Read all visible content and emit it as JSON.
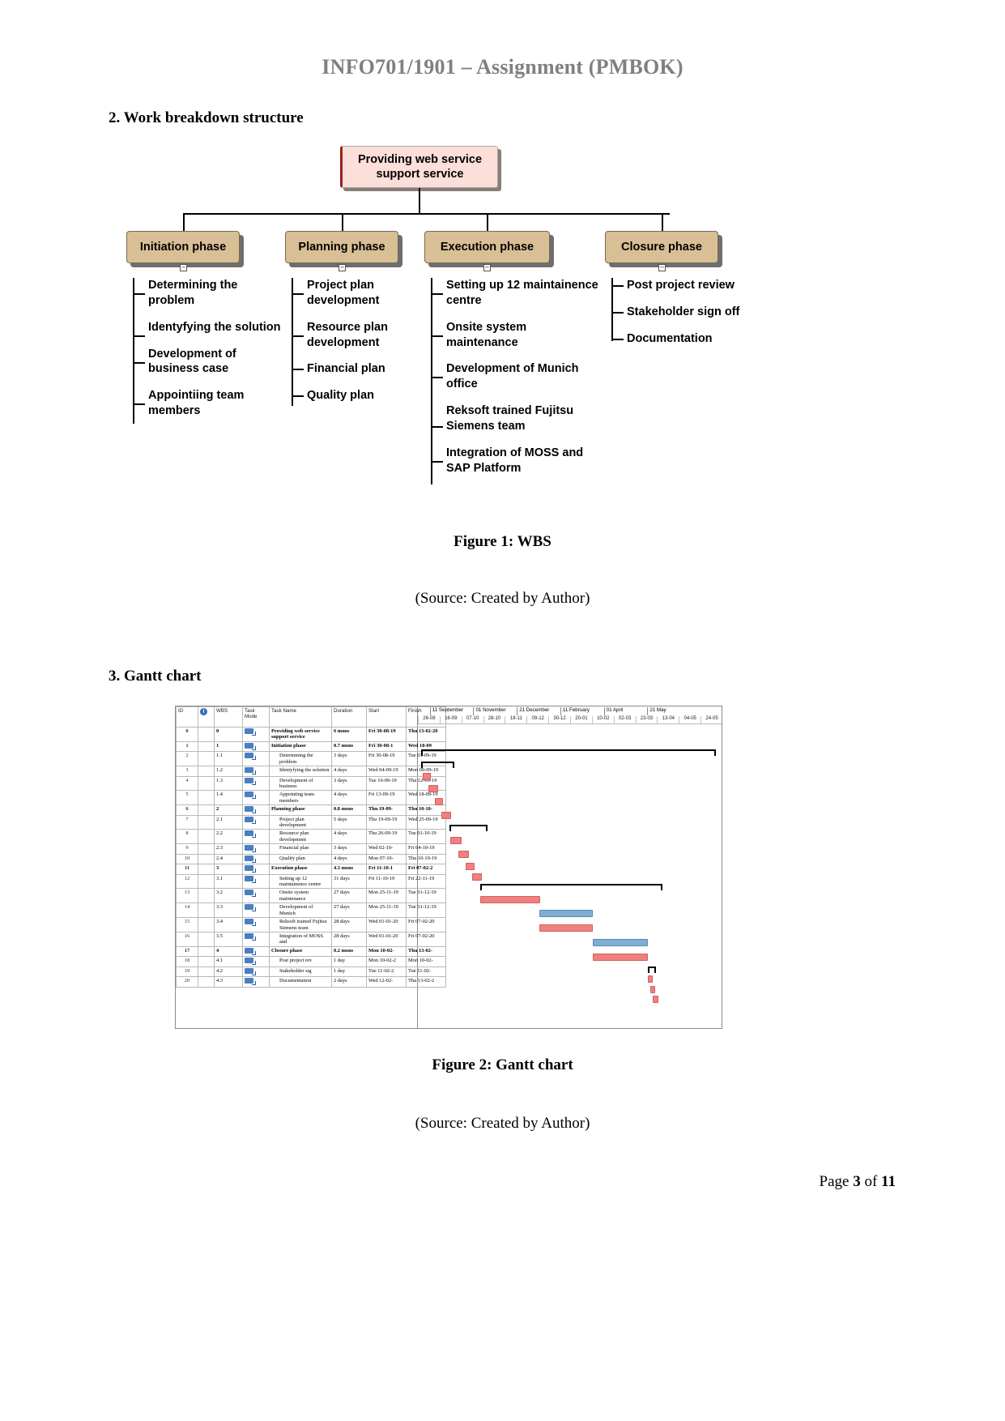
{
  "header": {
    "title": "INFO701/1901 – Assignment (PMBOK)"
  },
  "sections": {
    "wbs_heading": "2. Work breakdown structure",
    "gantt_heading": "3. Gantt chart"
  },
  "wbs": {
    "root": "Providing web service support service",
    "toggle_glyph": "–",
    "phases": [
      {
        "label": "Initiation phase",
        "items": [
          "Determining the problem",
          "Identyfying the solution",
          "Development of business case",
          "Appointiing team members"
        ]
      },
      {
        "label": "Planning phase",
        "items": [
          "Project plan development",
          "Resource plan development",
          "Financial plan",
          "Quality plan"
        ]
      },
      {
        "label": "Execution phase",
        "items": [
          "Setting up 12 maintainence centre",
          "Onsite system maintenance",
          "Development of Munich office",
          "Reksoft trained Fujitsu Siemens team",
          "Integration of MOSS and SAP Platform"
        ]
      },
      {
        "label": "Closure phase",
        "items": [
          "Post project review",
          "Stakeholder sign off",
          "Documentation"
        ]
      }
    ]
  },
  "figures": {
    "fig1_caption": "Figure 1: WBS",
    "fig1_source": "(Source: Created by Author)",
    "fig2_caption": "Figure 2: Gantt chart",
    "fig2_source": "(Source: Created by Author)"
  },
  "gantt": {
    "columns": [
      "ID",
      "",
      "WBS",
      "Task Mode",
      "Task Name",
      "Duration",
      "Start",
      "Finish"
    ],
    "info_icon_glyph": "i",
    "timeline": {
      "major_ticks": [
        "11 September",
        "01 November",
        "21 December",
        "11 February",
        "01 April",
        "21 May"
      ],
      "minor_ticks": [
        "26-08",
        "16-09",
        "07-10",
        "28-10",
        "18-11",
        "09-12",
        "30-12",
        "20-01",
        "10-02",
        "02-03",
        "23-03",
        "13-04",
        "04-05",
        "24-05"
      ]
    },
    "rows": [
      {
        "id": "0",
        "wbs": "0",
        "name": "Providing web service support service",
        "duration": "6 mons",
        "start": "Fri 30-08-19",
        "finish": "Thu 13-02-20",
        "summary": true,
        "indent": 0,
        "bar_start": 1.0,
        "bar_len": 97.0,
        "bar_type": "summary"
      },
      {
        "id": "1",
        "wbs": "1",
        "name": "Initiation phase",
        "duration": "0.7 mons",
        "start": "Fri 30-08-1",
        "finish": "Wed 18-09",
        "summary": true,
        "indent": 1,
        "bar_start": 1.0,
        "bar_len": 11.0,
        "bar_type": "summary"
      },
      {
        "id": "2",
        "wbs": "1.1",
        "name": "Determining the problem",
        "duration": "3 days",
        "start": "Fri 30-08-19",
        "finish": "Tue 03-09-19",
        "summary": false,
        "indent": 2,
        "bar_start": 1.5,
        "bar_len": 2.2,
        "bar_type": "task"
      },
      {
        "id": "3",
        "wbs": "1.2",
        "name": "Identyfying the solution",
        "duration": "4 days",
        "start": "Wed 04-09-19",
        "finish": "Mon 09-09-19",
        "summary": false,
        "indent": 2,
        "bar_start": 3.4,
        "bar_len": 2.6,
        "bar_type": "task"
      },
      {
        "id": "4",
        "wbs": "1.3",
        "name": "Development of business",
        "duration": "3 days",
        "start": "Tue 10-09-19",
        "finish": "Thu 12-09-19",
        "summary": false,
        "indent": 2,
        "bar_start": 5.6,
        "bar_len": 2.2,
        "bar_type": "task"
      },
      {
        "id": "5",
        "wbs": "1.4",
        "name": "Appointing team members",
        "duration": "4 days",
        "start": "Fri 13-09-19",
        "finish": "Wed 18-09-19",
        "summary": false,
        "indent": 2,
        "bar_start": 7.6,
        "bar_len": 2.8,
        "bar_type": "task"
      },
      {
        "id": "6",
        "wbs": "2",
        "name": "Planning phase",
        "duration": "0.8 mons",
        "start": "Thu 19-09-",
        "finish": "Thu 10-10-",
        "summary": true,
        "indent": 1,
        "bar_start": 10.4,
        "bar_len": 12.5,
        "bar_type": "summary"
      },
      {
        "id": "7",
        "wbs": "2.1",
        "name": "Project plan development",
        "duration": "5 days",
        "start": "Thu 19-09-19",
        "finish": "Wed 25-09-19",
        "summary": false,
        "indent": 2,
        "bar_start": 10.6,
        "bar_len": 3.2,
        "bar_type": "task"
      },
      {
        "id": "8",
        "wbs": "2.2",
        "name": "Resource plan development",
        "duration": "4 days",
        "start": "Thu 26-09-19",
        "finish": "Tue 01-10-19",
        "summary": false,
        "indent": 2,
        "bar_start": 13.4,
        "bar_len": 2.8,
        "bar_type": "task"
      },
      {
        "id": "9",
        "wbs": "2.3",
        "name": "Financial plan",
        "duration": "3 days",
        "start": "Wed 02-10-",
        "finish": "Fri 04-10-19",
        "summary": false,
        "indent": 2,
        "bar_start": 15.8,
        "bar_len": 2.2,
        "bar_type": "task"
      },
      {
        "id": "10",
        "wbs": "2.4",
        "name": "Quality plan",
        "duration": "4 days",
        "start": "Mon 07-10-",
        "finish": "Thu 10-10-19",
        "summary": false,
        "indent": 2,
        "bar_start": 17.8,
        "bar_len": 2.8,
        "bar_type": "task"
      },
      {
        "id": "11",
        "wbs": "3",
        "name": "Execution phase",
        "duration": "4.3 mons",
        "start": "Fri 11-10-1",
        "finish": "Fri 07-02-2",
        "summary": true,
        "indent": 1,
        "bar_start": 20.4,
        "bar_len": 60.0,
        "bar_type": "summary"
      },
      {
        "id": "12",
        "wbs": "3.1",
        "name": "Setting up 12 maintainence centre",
        "duration": "31 days",
        "start": "Fri 11-10-19",
        "finish": "Fri 22-11-19",
        "summary": false,
        "indent": 2,
        "bar_start": 20.6,
        "bar_len": 19.0,
        "bar_type": "task"
      },
      {
        "id": "13",
        "wbs": "3.2",
        "name": "Onsite system maintenance",
        "duration": "27 days",
        "start": "Mon 25-11-19",
        "finish": "Tue 31-12-19",
        "summary": false,
        "indent": 2,
        "bar_start": 40.0,
        "bar_len": 17.0,
        "bar_type": "task-blue"
      },
      {
        "id": "14",
        "wbs": "3.3",
        "name": "Development of Munich",
        "duration": "27 days",
        "start": "Mon 25-11-19",
        "finish": "Tue 31-12-19",
        "summary": false,
        "indent": 2,
        "bar_start": 40.0,
        "bar_len": 17.0,
        "bar_type": "task"
      },
      {
        "id": "15",
        "wbs": "3.4",
        "name": "Reksoft trained Fujitsu Siemens team",
        "duration": "28 days",
        "start": "Wed 01-01-20",
        "finish": "Fri 07-02-20",
        "summary": false,
        "indent": 2,
        "bar_start": 57.5,
        "bar_len": 17.5,
        "bar_type": "task-blue"
      },
      {
        "id": "16",
        "wbs": "3.5",
        "name": "Integration of MOSS and",
        "duration": "28 days",
        "start": "Wed 01-01-20",
        "finish": "Fri 07-02-20",
        "summary": false,
        "indent": 2,
        "bar_start": 57.5,
        "bar_len": 17.5,
        "bar_type": "task"
      },
      {
        "id": "17",
        "wbs": "4",
        "name": "Closure phase",
        "duration": "0.2 mons",
        "start": "Mon 10-02-",
        "finish": "Thu 13-02-",
        "summary": true,
        "indent": 1,
        "bar_start": 75.5,
        "bar_len": 2.8,
        "bar_type": "summary"
      },
      {
        "id": "18",
        "wbs": "4.1",
        "name": "Post project rev",
        "duration": "1 day",
        "start": "Mon 10-02-2",
        "finish": "Mon 10-02-",
        "summary": false,
        "indent": 2,
        "bar_start": 75.6,
        "bar_len": 1.0,
        "bar_type": "task"
      },
      {
        "id": "19",
        "wbs": "4.2",
        "name": "Stakeholder sig",
        "duration": "1 day",
        "start": "Tue 11-02-2",
        "finish": "Tue 11-02-",
        "summary": false,
        "indent": 2,
        "bar_start": 76.3,
        "bar_len": 1.0,
        "bar_type": "task"
      },
      {
        "id": "20",
        "wbs": "4.3",
        "name": "Documentation",
        "duration": "2 days",
        "start": "Wed 12-02-",
        "finish": "Thu 13-02-2",
        "summary": false,
        "indent": 2,
        "bar_start": 77.0,
        "bar_len": 1.4,
        "bar_type": "task"
      }
    ]
  },
  "footer": {
    "prefix": "Page ",
    "current": "3",
    "middle": " of ",
    "total": "11"
  }
}
